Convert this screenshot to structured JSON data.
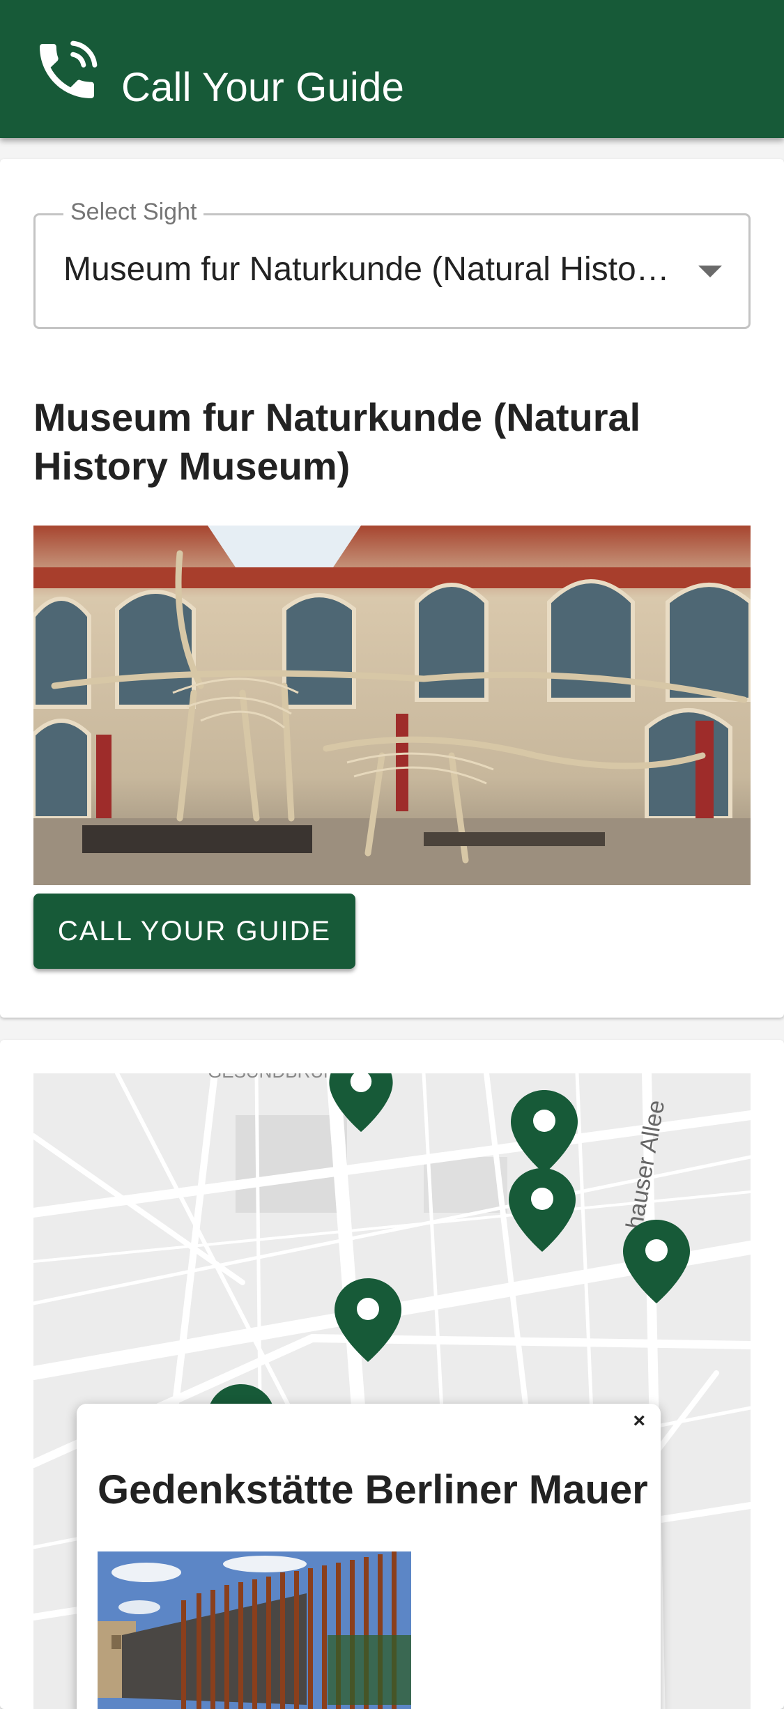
{
  "app": {
    "title": "Call Your Guide",
    "brand_color": "#175a38"
  },
  "select": {
    "label": "Select Sight",
    "value": "Museum fur Naturkunde (Natural History Museum)"
  },
  "sight": {
    "title": "Museum fur Naturkunde (Natural History Museum)",
    "photo_icon": "dinosaur-skeleton-hall"
  },
  "call_button": {
    "label": "CALL YOUR GUIDE"
  },
  "map": {
    "labels": {
      "street": "hauser Allee",
      "district": "GESUNDBRUNNEN"
    },
    "popup": {
      "title": "Gedenkstätte Berliner Mauer",
      "close": "×",
      "photo_icon": "berlin-wall-memorial"
    }
  }
}
